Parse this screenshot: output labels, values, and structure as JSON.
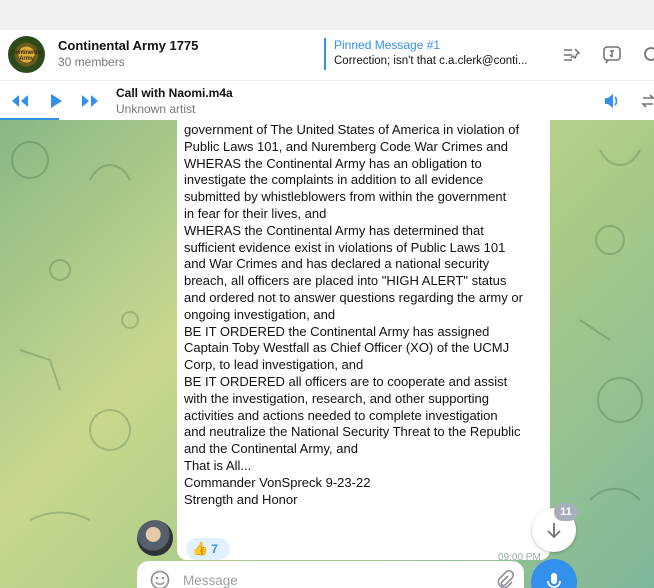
{
  "chat": {
    "title": "Continental Army 1775",
    "members": "30 members",
    "avatar_text": "Continental Army"
  },
  "pinned": {
    "title": "Pinned Message #1",
    "text": "Correction; isn't that c.a.clerk@conti..."
  },
  "header_icons": [
    "pinned-list-icon",
    "comments-icon",
    "search-icon"
  ],
  "audio": {
    "title": "Call with Naomi.m4a",
    "artist": "Unknown artist",
    "progress": 0.09
  },
  "message": {
    "lines": [
      "government of The United States of America in violation of",
      "Public Laws 101, and Nuremberg Code War Crimes and",
      "WHERAS the Continental Army has an obligation to",
      "investigate the complaints in addition to all evidence",
      "submitted by whistleblowers from within the government",
      "in fear for their lives, and",
      "WHERAS the Continental Army has determined that",
      "sufficient evidence exist in violations of Public Laws 101",
      "and War Crimes and has declared a national security",
      "breach, all officers are placed into \"HIGH ALERT\" status",
      "and ordered not to answer questions regarding the army or",
      "ongoing investigation, and",
      "BE IT ORDERED the Continental Army has assigned",
      "Captain Toby Westfall as Chief Officer (XO) of the UCMJ",
      "Corp, to lead investigation, and",
      "BE IT ORDERED all officers are to cooperate and assist",
      "with the investigation, research, and other supporting",
      "activities and actions needed to complete investigation",
      "and neutralize the National Security Threat to the Republic",
      "and the Continental Army, and",
      "That is All...",
      "Commander VonSpreck 9-23-22",
      "Strength and Honor"
    ],
    "reaction_emoji": "👍",
    "reaction_count": "7",
    "time": "09:00 PM"
  },
  "unread_count": "11",
  "composer": {
    "placeholder": "Message"
  },
  "colors": {
    "accent": "#3390ec",
    "background_gradient": [
      "#88b884",
      "#c9d88f",
      "#7fb79a"
    ]
  }
}
